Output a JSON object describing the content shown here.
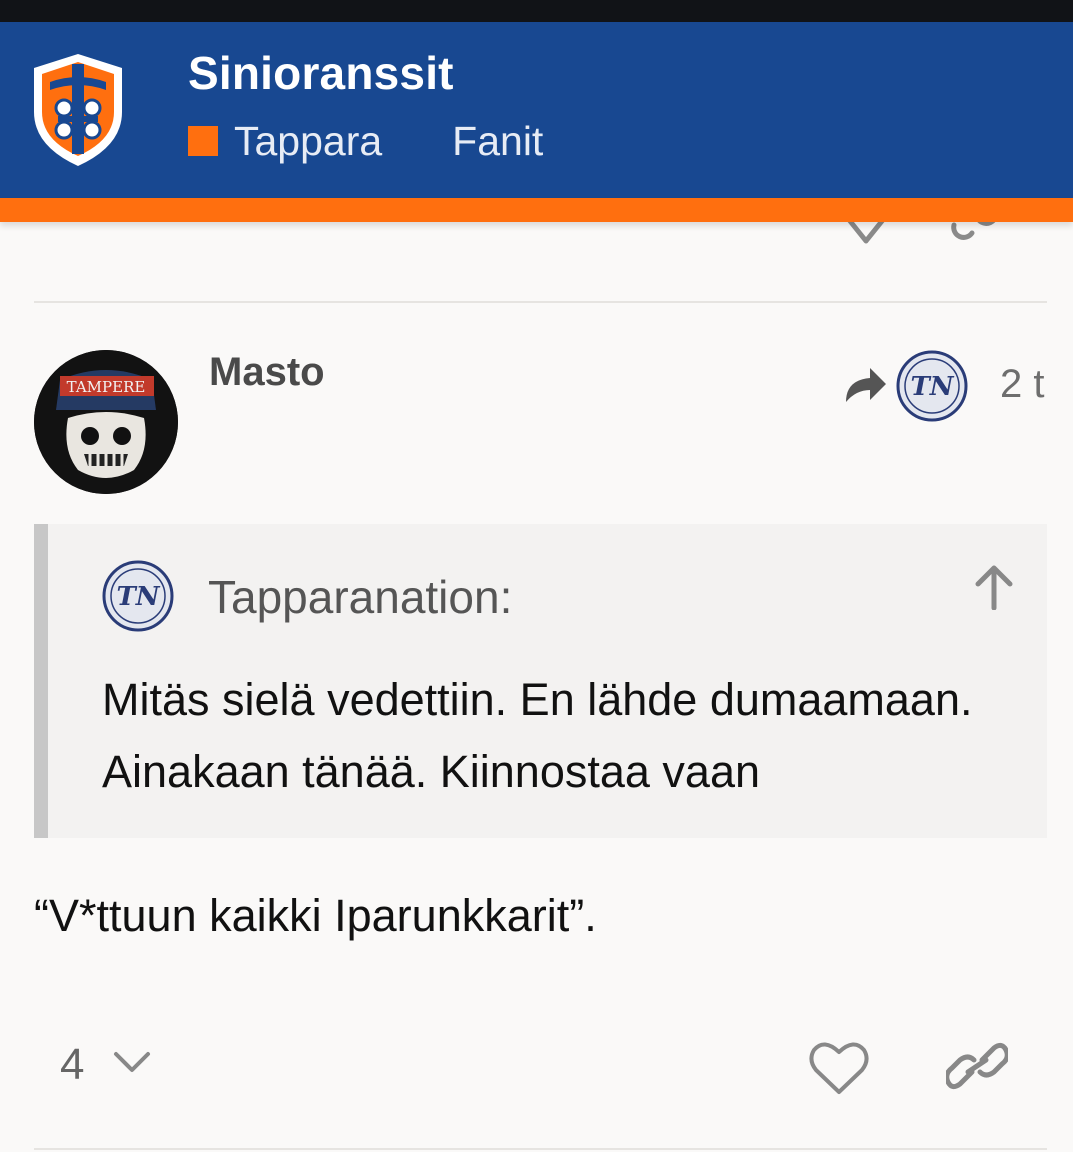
{
  "header": {
    "site_title": "Sinioranssit",
    "category": "Tappara",
    "subcategory": "Fanit",
    "logo_icon": "tappara-shield-logo",
    "brand_color": "#184891",
    "accent_color": "#ff6f0f"
  },
  "post": {
    "username": "Masto",
    "time": "2 t",
    "reply_icon": "reply-arrow-icon",
    "quote": {
      "author": "Tapparanation:",
      "text": "Mitäs sielä vedettiin. En lähde dumaamaan. Ainakaan tänää. Kiinnostaa vaan"
    },
    "body": "“V*ttuun kaikki Iparunkkarit”.",
    "actions": {
      "like_count": "4",
      "like_icon": "heart-icon",
      "link_icon": "link-icon"
    }
  }
}
